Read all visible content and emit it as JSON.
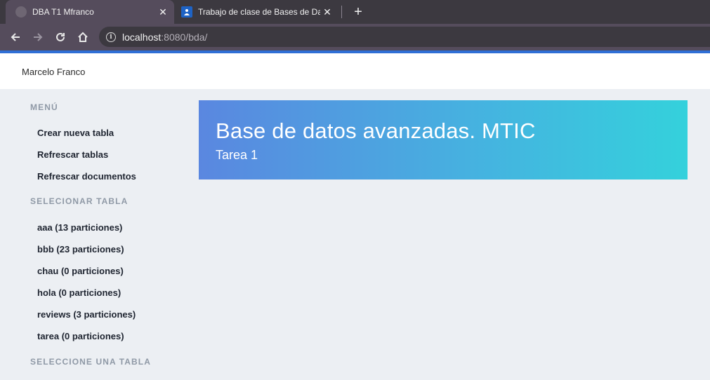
{
  "browser": {
    "tabs": [
      {
        "title": "DBA T1 Mfranco",
        "active": true
      },
      {
        "title": "Trabajo de clase de Bases de Dat",
        "active": false
      }
    ],
    "close_glyph": "✕",
    "new_tab_glyph": "+",
    "url_host": "localhost",
    "url_rest": ":8080/bda/"
  },
  "header": {
    "brand": "Marcelo Franco"
  },
  "sidebar": {
    "menu_heading": "MENÚ",
    "menu_items": [
      "Crear nueva tabla",
      "Refrescar tablas",
      "Refrescar documentos"
    ],
    "select_heading": "SELECIONAR TABLA",
    "tables": [
      "aaa (13 particiones)",
      "bbb (23 particiones)",
      "chau (0 particiones)",
      "hola (0 particiones)",
      "reviews (3 particiones)",
      "tarea (0 particiones)"
    ],
    "choose_heading": "SELECCIONE UNA TABLA"
  },
  "hero": {
    "title": "Base de datos avanzadas. MTIC",
    "subtitle": "Tarea 1"
  },
  "colors": {
    "accent": "#2f6fd6",
    "hero_start": "#5a87e0",
    "hero_end": "#34d1dc"
  }
}
